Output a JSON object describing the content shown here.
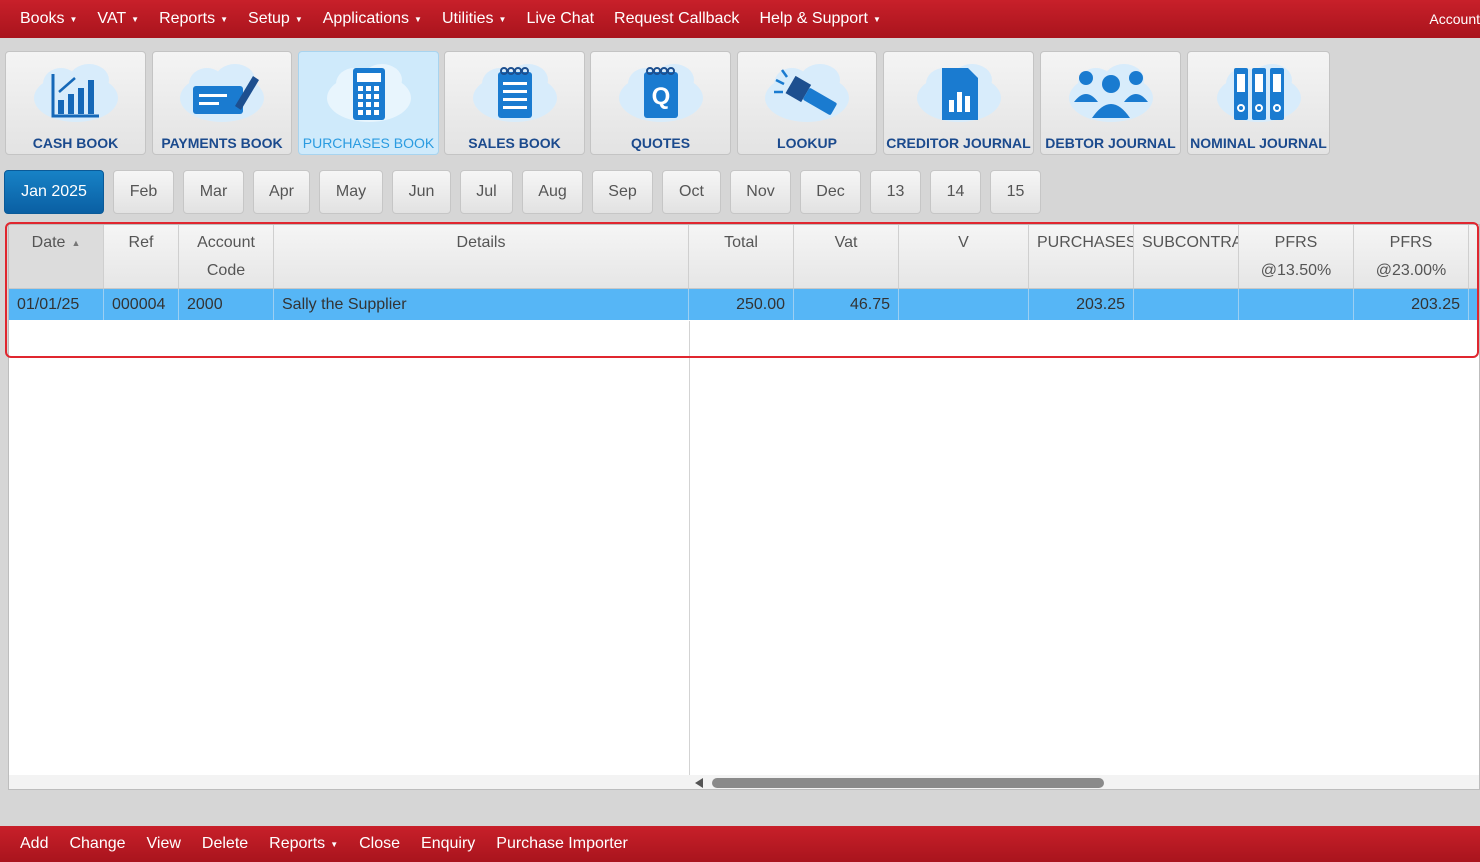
{
  "menu": {
    "items": [
      {
        "label": "Books",
        "dropdown": true
      },
      {
        "label": "VAT",
        "dropdown": true
      },
      {
        "label": "Reports",
        "dropdown": true
      },
      {
        "label": "Setup",
        "dropdown": true
      },
      {
        "label": "Applications",
        "dropdown": true
      },
      {
        "label": "Utilities",
        "dropdown": true
      },
      {
        "label": "Live Chat",
        "dropdown": false
      },
      {
        "label": "Request Callback",
        "dropdown": false
      },
      {
        "label": "Help & Support",
        "dropdown": true
      }
    ],
    "account": "Account"
  },
  "toolbar": {
    "buttons": [
      {
        "label": "CASH BOOK",
        "icon": "chart-icon",
        "active": false
      },
      {
        "label": "PAYMENTS BOOK",
        "icon": "cheque-icon",
        "active": false
      },
      {
        "label": "PURCHASES BOOK",
        "icon": "calculator-icon",
        "active": true
      },
      {
        "label": "SALES BOOK",
        "icon": "notepad-icon",
        "active": false
      },
      {
        "label": "QUOTES",
        "icon": "quote-icon",
        "active": false
      },
      {
        "label": "LOOKUP",
        "icon": "flashlight-icon",
        "active": false
      },
      {
        "label": "CREDITOR JOURNAL",
        "icon": "document-chart-icon",
        "active": false
      },
      {
        "label": "DEBTOR JOURNAL",
        "icon": "people-icon",
        "active": false
      },
      {
        "label": "NOMINAL JOURNAL",
        "icon": "binders-icon",
        "active": false
      }
    ]
  },
  "months": [
    "Jan 2025",
    "Feb",
    "Mar",
    "Apr",
    "May",
    "Jun",
    "Jul",
    "Aug",
    "Sep",
    "Oct",
    "Nov",
    "Dec",
    "13",
    "14",
    "15"
  ],
  "active_month": "Jan 2025",
  "grid": {
    "columns": [
      {
        "line1": "Date",
        "line2": "",
        "sorted": true
      },
      {
        "line1": "Ref",
        "line2": ""
      },
      {
        "line1": "Account",
        "line2": "Code"
      },
      {
        "line1": "Details",
        "line2": ""
      },
      {
        "line1": "Total",
        "line2": ""
      },
      {
        "line1": "Vat",
        "line2": ""
      },
      {
        "line1": "V",
        "line2": ""
      },
      {
        "line1": "PURCHASES",
        "line2": ""
      },
      {
        "line1": "SUBCONTRA",
        "line2": ""
      },
      {
        "line1": "PFRS",
        "line2": "@13.50%"
      },
      {
        "line1": "PFRS",
        "line2": "@23.00%"
      }
    ],
    "rows": [
      {
        "date": "01/01/25",
        "ref": "000004",
        "account_code": "2000",
        "details": "Sally the Supplier",
        "total": "250.00",
        "vat": "46.75",
        "v": "",
        "purchases": "203.25",
        "subcontra": "",
        "pfrs_1350": "",
        "pfrs_2300": "203.25"
      }
    ]
  },
  "bottom": {
    "items": [
      {
        "label": "Add",
        "dropdown": false
      },
      {
        "label": "Change",
        "dropdown": false
      },
      {
        "label": "View",
        "dropdown": false
      },
      {
        "label": "Delete",
        "dropdown": false
      },
      {
        "label": "Reports",
        "dropdown": true
      },
      {
        "label": "Close",
        "dropdown": false
      },
      {
        "label": "Enquiry",
        "dropdown": false
      },
      {
        "label": "Purchase Importer",
        "dropdown": false
      }
    ]
  },
  "colors": {
    "brand_red": "#b71a22",
    "active_blue": "#0a6ab0",
    "row_selected": "#56b6f6",
    "label_blue": "#1b4a8d"
  }
}
